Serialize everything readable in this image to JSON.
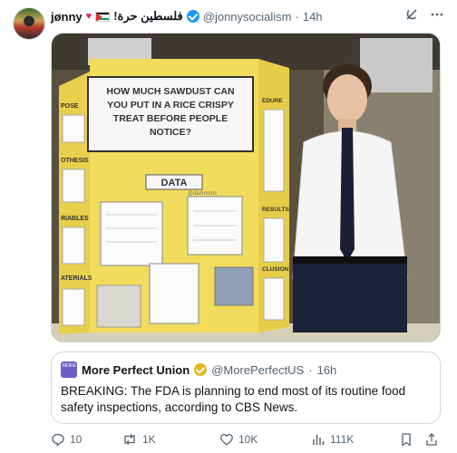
{
  "post": {
    "author": {
      "display_name": "jønny",
      "heart": "♥",
      "arabic_text": "فلسطين حرة!",
      "handle": "@jonnysocialism",
      "separator": "·",
      "timestamp": "14h"
    },
    "media": {
      "board_question": [
        "HOW MUCH SAWDUST CAN",
        "YOU PUT IN A RICE CRISPY",
        "TREAT BEFORE PEOPLE",
        "NOTICE?"
      ],
      "data_label": "DATA",
      "watermark": "@dadmoms",
      "left_panel_labels": [
        "POSE",
        "OTHESIS",
        "RIABLES",
        "ATERIALS"
      ],
      "right_panel_labels": [
        "EDURE",
        "RESULTS",
        "CLUSION"
      ]
    },
    "quoted": {
      "avatar_text": "MORE PERFECT UNION",
      "display_name": "More Perfect Union",
      "handle": "@MorePerfectUS",
      "separator": "·",
      "timestamp": "16h",
      "text": "BREAKING: The FDA is planning to end most of its routine food safety inspections, according to CBS News."
    },
    "actions": {
      "replies": "10",
      "reposts": "1K",
      "likes": "10K",
      "views": "111K"
    }
  },
  "colors": {
    "verified_blue": "#1d9bf0",
    "org_gold": "#e2b719",
    "board_yellow": "#f2dc5d",
    "muted_text": "#536471"
  },
  "icons": [
    "grok-icon",
    "more-icon",
    "reply-icon",
    "repost-icon",
    "like-icon",
    "views-icon",
    "bookmark-icon",
    "share-icon"
  ]
}
